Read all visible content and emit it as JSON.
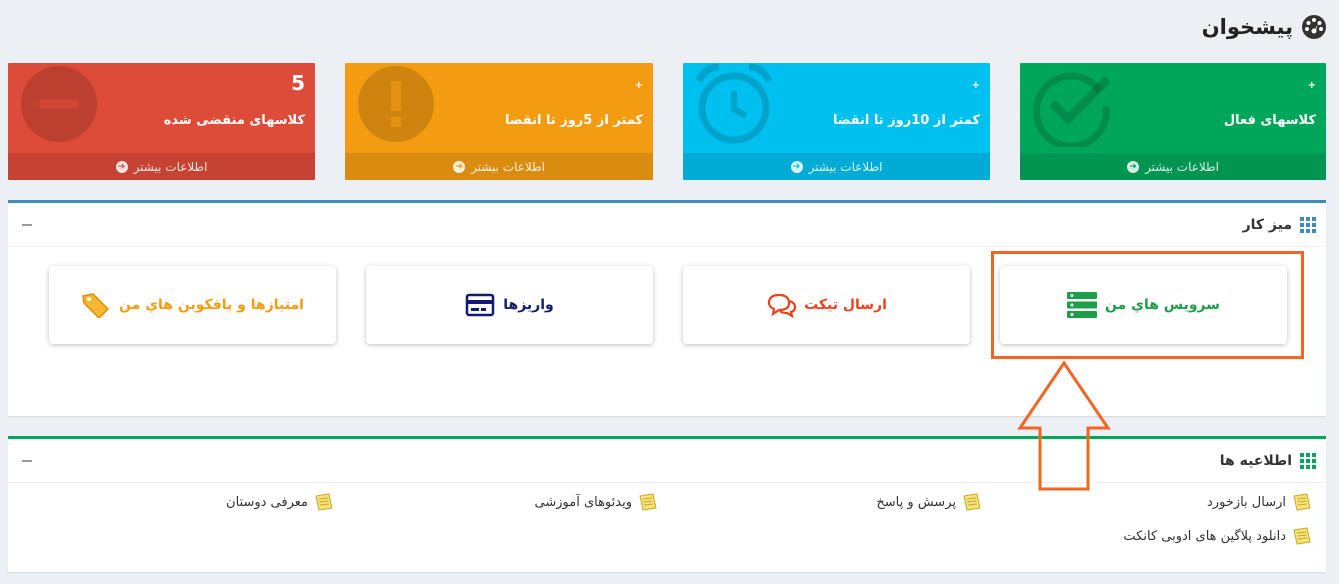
{
  "header": {
    "title": "پیشخوان",
    "icon": "dashboard-icon"
  },
  "stats": [
    {
      "count": "5",
      "label": "کلاسهای منقضی شده",
      "more": "اطلاعات بیشتر",
      "color": "#dd4b39",
      "icon": "minus-circle-icon"
    },
    {
      "count": "+",
      "label": "کمتر از 5روز تا انقضا",
      "more": "اطلاعات بیشتر",
      "color": "#f39c12",
      "icon": "exclamation-circle-icon"
    },
    {
      "count": "+",
      "label": "کمتر از 10روز تا انقضا",
      "more": "اطلاعات بیشتر",
      "color": "#00c0ef",
      "icon": "alarm-clock-icon"
    },
    {
      "count": "+",
      "label": "کلاسهای فعال",
      "more": "اطلاعات بیشتر",
      "color": "#00a65a",
      "icon": "check-circle-icon"
    }
  ],
  "desk": {
    "title": "میز کار",
    "accent": "#3c8dbc",
    "tiles": [
      {
        "label": "سرویس هاي من",
        "color": "#1e9e4a",
        "icon": "server-icon"
      },
      {
        "label": "ارسال تیکت",
        "color": "#e8431c",
        "icon": "comments-icon"
      },
      {
        "label": "واریزها",
        "color": "#111c6e",
        "icon": "credit-card-icon"
      },
      {
        "label": "امتیازها و پافکوبن هاي من",
        "color": "#f39c12",
        "icon": "tag-icon"
      }
    ]
  },
  "announcements": {
    "title": "اطلاعیه ها",
    "accent": "#00a65a",
    "links": [
      {
        "label": "ارسال بازخورد",
        "icon": "note-icon"
      },
      {
        "label": "پرسش و پاسخ",
        "icon": "note-icon"
      },
      {
        "label": "ویدئوهای آموزشی",
        "icon": "note-icon"
      },
      {
        "label": "معرفی دوستان",
        "icon": "note-icon"
      },
      {
        "label": "دانلود پلاگین های ادوبی کانکت",
        "icon": "note-icon"
      }
    ]
  },
  "annotation": {
    "color": "#f26522"
  }
}
